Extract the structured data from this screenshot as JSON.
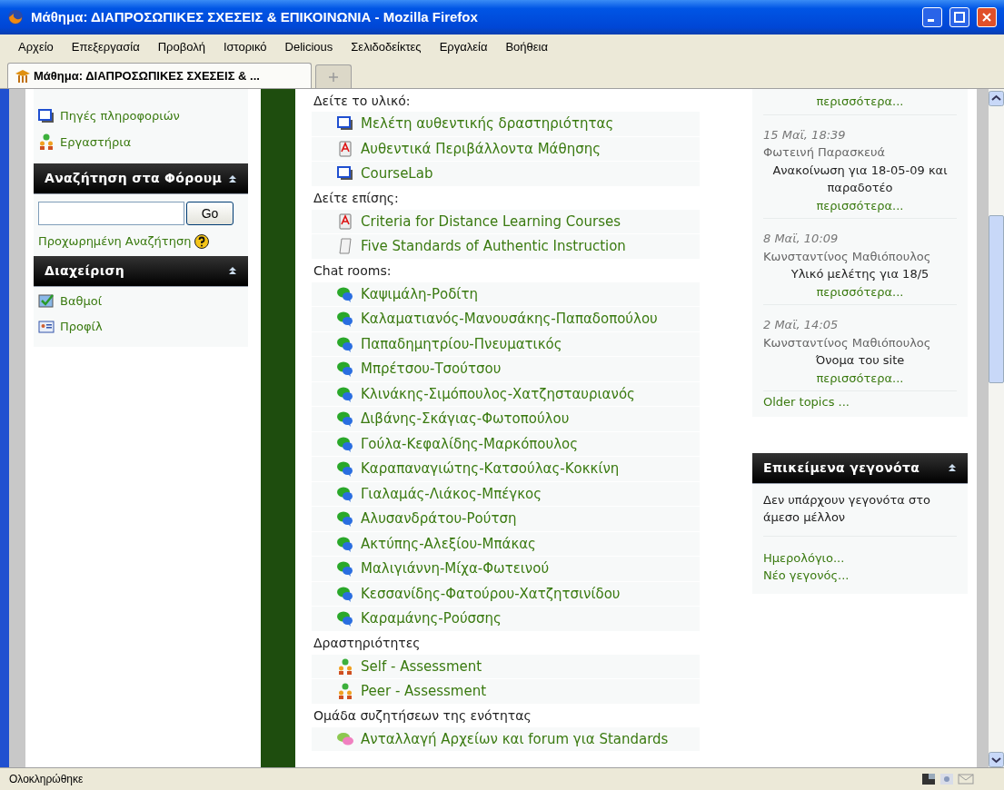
{
  "window": {
    "title": "Μάθημα: ΔΙΑΠΡΟΣΩΠΙΚΕΣ ΣΧΕΣΕΙΣ & ΕΠΙΚΟΙΝΩΝΙΑ - Mozilla Firefox"
  },
  "menu": [
    "Αρχείο",
    "Επεξεργασία",
    "Προβολή",
    "Ιστορικό",
    "Delicious",
    "Σελιδοδείκτες",
    "Εργαλεία",
    "Βοήθεια"
  ],
  "tabs": [
    {
      "label": "Μάθημα: ΔΙΑΠΡΟΣΩΠΙΚΕΣ ΣΧΕΣΕΙΣ & ...",
      "selected": true
    }
  ],
  "left": {
    "items": [
      {
        "label": "Πηγές πληροφοριών",
        "kind": "resource"
      },
      {
        "label": "Εργαστήρια",
        "kind": "workshop"
      }
    ],
    "search": {
      "title": "Αναζήτηση στα Φόρουμ",
      "button": "Go",
      "advanced": "Προχωρημένη Αναζήτηση"
    },
    "admin": {
      "title": "Διαχείριση",
      "items": [
        {
          "label": "Βαθμοί",
          "kind": "grades"
        },
        {
          "label": "Προφίλ",
          "kind": "profile"
        }
      ]
    }
  },
  "main": {
    "sections": [
      {
        "heading": "Δείτε το υλικό:",
        "items": [
          {
            "label": "Μελέτη αυθεντικής δραστηριότητας",
            "kind": "resource"
          },
          {
            "label": "Αυθεντικά Περιβάλλοντα Μάθησης",
            "kind": "pdf"
          },
          {
            "label": "CourseLab",
            "kind": "resource"
          }
        ]
      },
      {
        "heading": "Δείτε επίσης:",
        "items": [
          {
            "label": "Criteria for Distance Learning Courses",
            "kind": "pdf"
          },
          {
            "label": "Five Standards of Authentic Instruction",
            "kind": "doc"
          }
        ]
      },
      {
        "heading": "Chat rooms:",
        "items": [
          {
            "label": "Καψιμάλη-Ροδίτη",
            "kind": "chat"
          },
          {
            "label": "Καλαματιανός-Μανουσάκης-Παπαδοπούλου",
            "kind": "chat"
          },
          {
            "label": "Παπαδημητρίου-Πνευματικός",
            "kind": "chat"
          },
          {
            "label": "Μπρέτσου-Τσούτσου",
            "kind": "chat"
          },
          {
            "label": "Κλινάκης-Σιμόπουλος-Χατζησταυριανός",
            "kind": "chat"
          },
          {
            "label": "Διβάνης-Σκάγιας-Φωτοπούλου",
            "kind": "chat"
          },
          {
            "label": "Γούλα-Κεφαλίδης-Μαρκόπουλος",
            "kind": "chat"
          },
          {
            "label": "Καραπαναγιώτης-Κατσούλας-Κοκκίνη",
            "kind": "chat"
          },
          {
            "label": "Γιαλαμάς-Λιάκος-Μπέγκος",
            "kind": "chat"
          },
          {
            "label": "Αλυσανδράτου-Ρούτση",
            "kind": "chat"
          },
          {
            "label": "Ακτύπης-Αλεξίου-Μπάκας",
            "kind": "chat"
          },
          {
            "label": "Μαλιγιάννη-Μίχα-Φωτεινού",
            "kind": "chat"
          },
          {
            "label": "Κεσσανίδης-Φατούρου-Χατζητσινίδου",
            "kind": "chat"
          },
          {
            "label": "Καραμάνης-Ρούσσης",
            "kind": "chat"
          }
        ]
      },
      {
        "heading": "Δραστηριότητες",
        "items": [
          {
            "label": "Self - Assessment",
            "kind": "workshop"
          },
          {
            "label": "Peer - Assessment",
            "kind": "workshop"
          }
        ]
      },
      {
        "heading": "Ομάδα συζητήσεων της ενότητας",
        "items": [
          {
            "label": "Ανταλλαγή Αρχείων και forum για Standards",
            "kind": "forum"
          }
        ]
      }
    ]
  },
  "news": {
    "items": [
      {
        "more": "περισσότερα..."
      },
      {
        "date": "15 Μαϊ, 18:39",
        "author": "Φωτεινή Παρασκευά",
        "title": "Ανακοίνωση για 18-05-09 και παραδοτέο",
        "more": "περισσότερα..."
      },
      {
        "date": "8 Μαϊ, 10:09",
        "author": "Κωνσταντίνος Μαθιόπουλος",
        "title": "Υλικό μελέτης για 18/5",
        "more": "περισσότερα..."
      },
      {
        "date": "2 Μαϊ, 14:05",
        "author": "Κωνσταντίνος Μαθιόπουλος",
        "title": "Όνομα του site",
        "more": "περισσότερα..."
      }
    ],
    "older": "Older topics ..."
  },
  "events": {
    "title": "Επικείμενα γεγονότα",
    "text": "Δεν υπάρχουν γεγονότα στο άμεσο μέλλον",
    "links": [
      "Ημερολόγιο...",
      "Νέο γεγονός..."
    ]
  },
  "status_bar": {
    "text": "Ολοκληρώθηκε"
  }
}
